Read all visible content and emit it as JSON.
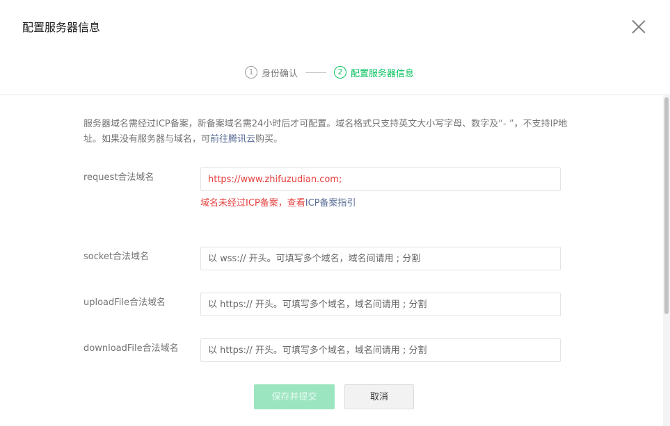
{
  "dialog": {
    "title": "配置服务器信息"
  },
  "steps": [
    {
      "number": "1",
      "label": "身份确认",
      "state": "done"
    },
    {
      "number": "2",
      "label": "配置服务器信息",
      "state": "active"
    }
  ],
  "notice": {
    "text": "服务器域名需经过ICP备案，新备案域名需24小时后才可配置。域名格式只支持英文大小写字母、数字及“- ”，不支持IP地址。如果没有服务器与域名，可",
    "link": "前往腾讯云",
    "suffix": "购买。"
  },
  "fields": {
    "request": {
      "label": "request合法域名",
      "value": "https://www.zhifuzudian.com;"
    },
    "socket": {
      "label": "socket合法域名",
      "placeholder": "以 wss:// 开头。可填写多个域名，域名间请用 ; 分割"
    },
    "uploadFile": {
      "label": "uploadFile合法域名",
      "placeholder": "以 https:// 开头。可填写多个域名，域名间请用 ; 分割"
    },
    "downloadFile": {
      "label": "downloadFile合法域名",
      "placeholder": "以 https:// 开头。可填写多个域名，域名间请用 ; 分割"
    }
  },
  "error": {
    "text": "域名未经过ICP备案，查看",
    "link": "ICP备案指引"
  },
  "buttons": {
    "submit": "保存并提交",
    "cancel": "取消"
  },
  "colors": {
    "accent": "#07c160",
    "error": "#e64340",
    "link": "#576b95",
    "submit_disabled": "#9ce5c1"
  },
  "icons": {
    "close": "close-icon"
  }
}
